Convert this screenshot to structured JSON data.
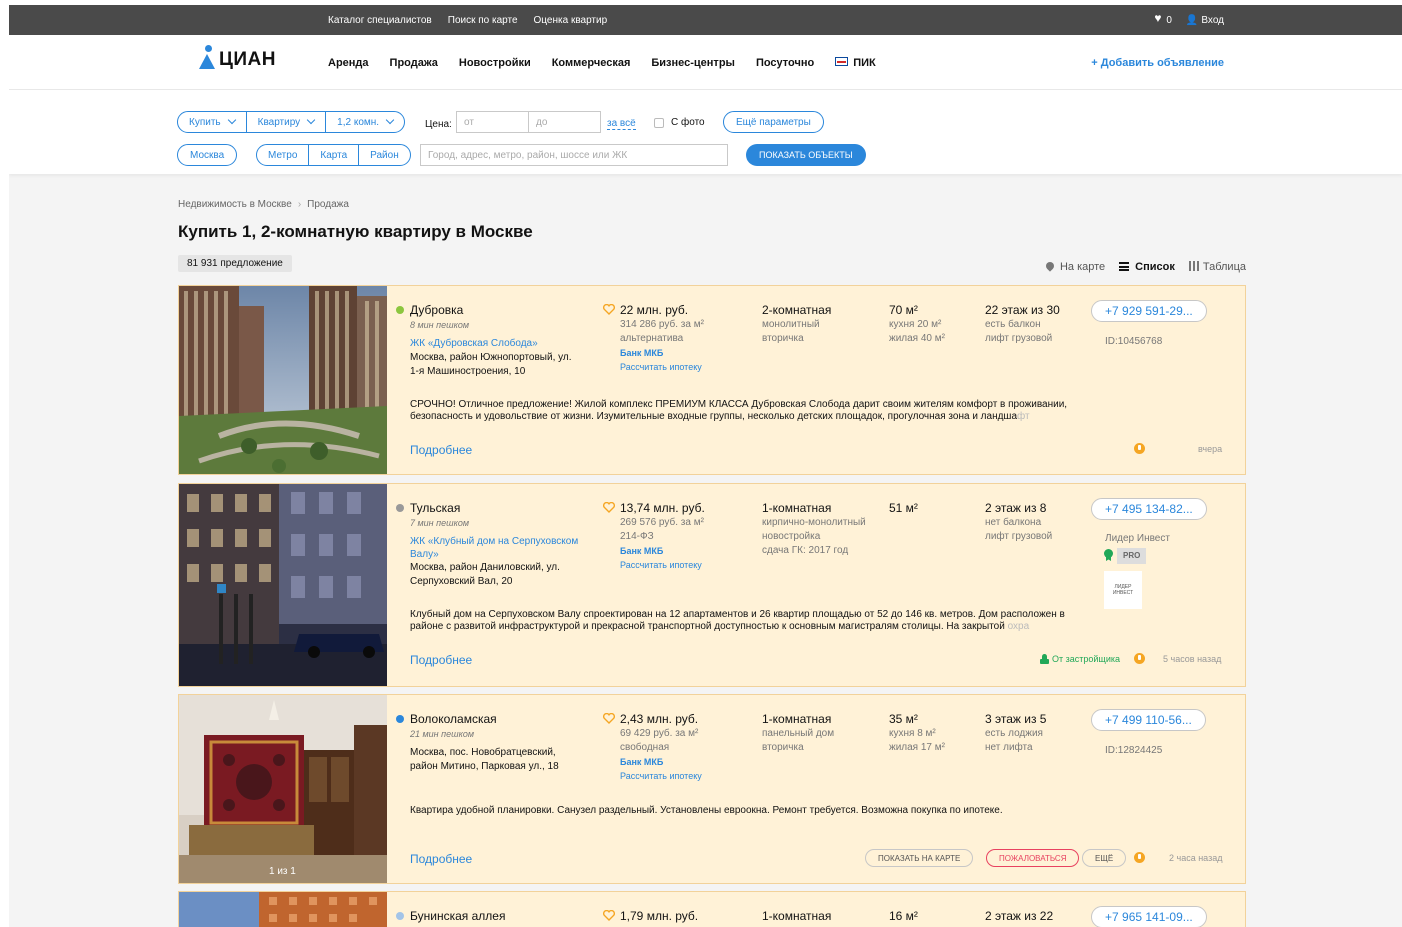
{
  "topbar": {
    "links": [
      "Каталог специалистов",
      "Поиск по карте",
      "Оценка квартир"
    ],
    "favorites_count": "0",
    "login": "Вход"
  },
  "header": {
    "logo_text": "ЦИАН",
    "nav": [
      "Аренда",
      "Продажа",
      "Новостройки",
      "Коммерческая",
      "Бизнес-центры",
      "Посуточно"
    ],
    "pik": "ПИК",
    "add_ad": "+ Добавить объявление"
  },
  "filters": {
    "deal": "Купить",
    "type": "Квартиру",
    "rooms": "1,2 комн.",
    "price_label": "Цена:",
    "price_from_placeholder": "от",
    "price_to_placeholder": "до",
    "price_unit": "за всё",
    "with_photo": "С фото",
    "more_params": "Ещё параметры",
    "city": "Москва",
    "geo_tabs": [
      "Метро",
      "Карта",
      "Район"
    ],
    "search_placeholder": "Город, адрес, метро, район, шоссе или ЖК",
    "show_button": "ПОКАЗАТЬ ОБЪЕКТЫ"
  },
  "page": {
    "breadcrumb": [
      "Недвижимость в Москве",
      "Продажа"
    ],
    "title": "Купить 1, 2-комнатную квартиру в Москве",
    "count": "81 931 предложение",
    "views": [
      "На карте",
      "Список",
      "Таблица"
    ]
  },
  "listings": [
    {
      "metro": "Дубровка",
      "metro_color": "#8cc63f",
      "walk": "8 мин пешком",
      "complex": "ЖК «Дубровская Слобода»",
      "address": [
        "Москва, район Южнопортовый, ул.",
        "1-я Машиностроения, 10"
      ],
      "price": "22 млн. руб.",
      "price_per_m": "314 286 руб. за м²",
      "deal_type": "альтернатива",
      "bank": "Банк МКБ",
      "mortgage": "Рассчитать ипотеку",
      "rooms": "2-комнатная",
      "house_type": "монолитный",
      "market": "вторичка",
      "area": "70 м²",
      "kitchen": "кухня 20 м²",
      "living": "жилая 40 м²",
      "floor": "22 этаж из 30",
      "balcony": "есть балкон",
      "lift": "лифт грузовой",
      "phone": "+7 929 591-29...",
      "id": "ID:10456768",
      "description": "СРОЧНО! Отличное предложение! Жилой комплекс ПРЕМИУМ КЛАССА Дубровская Слобода дарит своим жителям комфорт в проживании,",
      "description2": "безопасность и удовольствие от жизни. Изумительные входные группы, несколько детских площадок, прогулочная зона и ландша",
      "description2_fade": "фт",
      "more": "Подробнее",
      "time": "вчера"
    },
    {
      "metro": "Тульская",
      "metro_color": "#999999",
      "walk": "7 мин пешком",
      "complex": "ЖК «Клубный дом на Серпуховском Валу»",
      "complex_lines": [
        "ЖК «Клубный дом на Серпуховском",
        "Валу»"
      ],
      "address": [
        "Москва, район Даниловский, ул.",
        "Серпуховский Вал, 20"
      ],
      "price": "13,74 млн. руб.",
      "price_per_m": "269 576 руб. за м²",
      "deal_type": "214-ФЗ",
      "bank": "Банк МКБ",
      "mortgage": "Рассчитать ипотеку",
      "rooms": "1-комнатная",
      "house_type": "кирпично-монолитный",
      "market": "новостройка",
      "deadline": "сдача ГК: 2017 год",
      "area": "51 м²",
      "floor": "2 этаж из 8",
      "balcony": "нет балкона",
      "lift": "лифт грузовой",
      "phone": "+7 495 134-82...",
      "agent": "Лидер Инвест",
      "pro": "PRO",
      "dev_logo": "ЛИДЕР ИНВЕСТ",
      "description": "Клубный дом на Серпуховском Валу спроектирован на 12 апартаментов и 26 квартир площадью от 52 до 146 кв. метров. Дом расположен в",
      "description2": "районе с развитой инфраструктурой и прекрасной транспортной доступностью к основным магистралям столицы. На закрытой ",
      "description2_fade": "охра",
      "more": "Подробнее",
      "builder": "От застройщика",
      "time": "5 часов назад"
    },
    {
      "metro": "Волоколамская",
      "metro_color": "#2b87db",
      "walk": "21 мин пешком",
      "address": [
        "Москва, пос. Новобратцевский,",
        "район Митино, Парковая ул., 18"
      ],
      "price": "2,43 млн. руб.",
      "price_per_m": "69 429 руб. за м²",
      "deal_type": "свободная",
      "bank": "Банк МКБ",
      "mortgage": "Рассчитать ипотеку",
      "rooms": "1-комнатная",
      "house_type": "панельный дом",
      "market": "вторичка",
      "area": "35 м²",
      "kitchen": "кухня 8 м²",
      "living": "жилая 17 м²",
      "floor": "3 этаж из 5",
      "balcony": "есть лоджия",
      "lift": "нет лифта",
      "phone": "+7 499 110-56...",
      "id": "ID:12824425",
      "description": "Квартира удобной планировки. Санузел раздельный. Установлены евроокна. Ремонт требуется. Возможна покупка по ипотеке.",
      "photo_count": "1 из 1",
      "more": "Подробнее",
      "actions": [
        "ПОКАЗАТЬ НА КАРТЕ",
        "ПОЖАЛОВАТЬСЯ",
        "ЕЩЁ"
      ],
      "time": "2 часа назад"
    },
    {
      "metro": "Бунинская аллея",
      "metro_color": "#a3c4e8",
      "price": "1,79 млн. руб.",
      "rooms": "1-комнатная",
      "area": "16 м²",
      "floor": "2 этаж из 22",
      "phone": "+7 965 141-09..."
    }
  ],
  "colors": {
    "accent": "#2b87db",
    "card_bg": "#fff2d7",
    "topbar": "#4a4a4a",
    "highlight": "#f5a623"
  }
}
